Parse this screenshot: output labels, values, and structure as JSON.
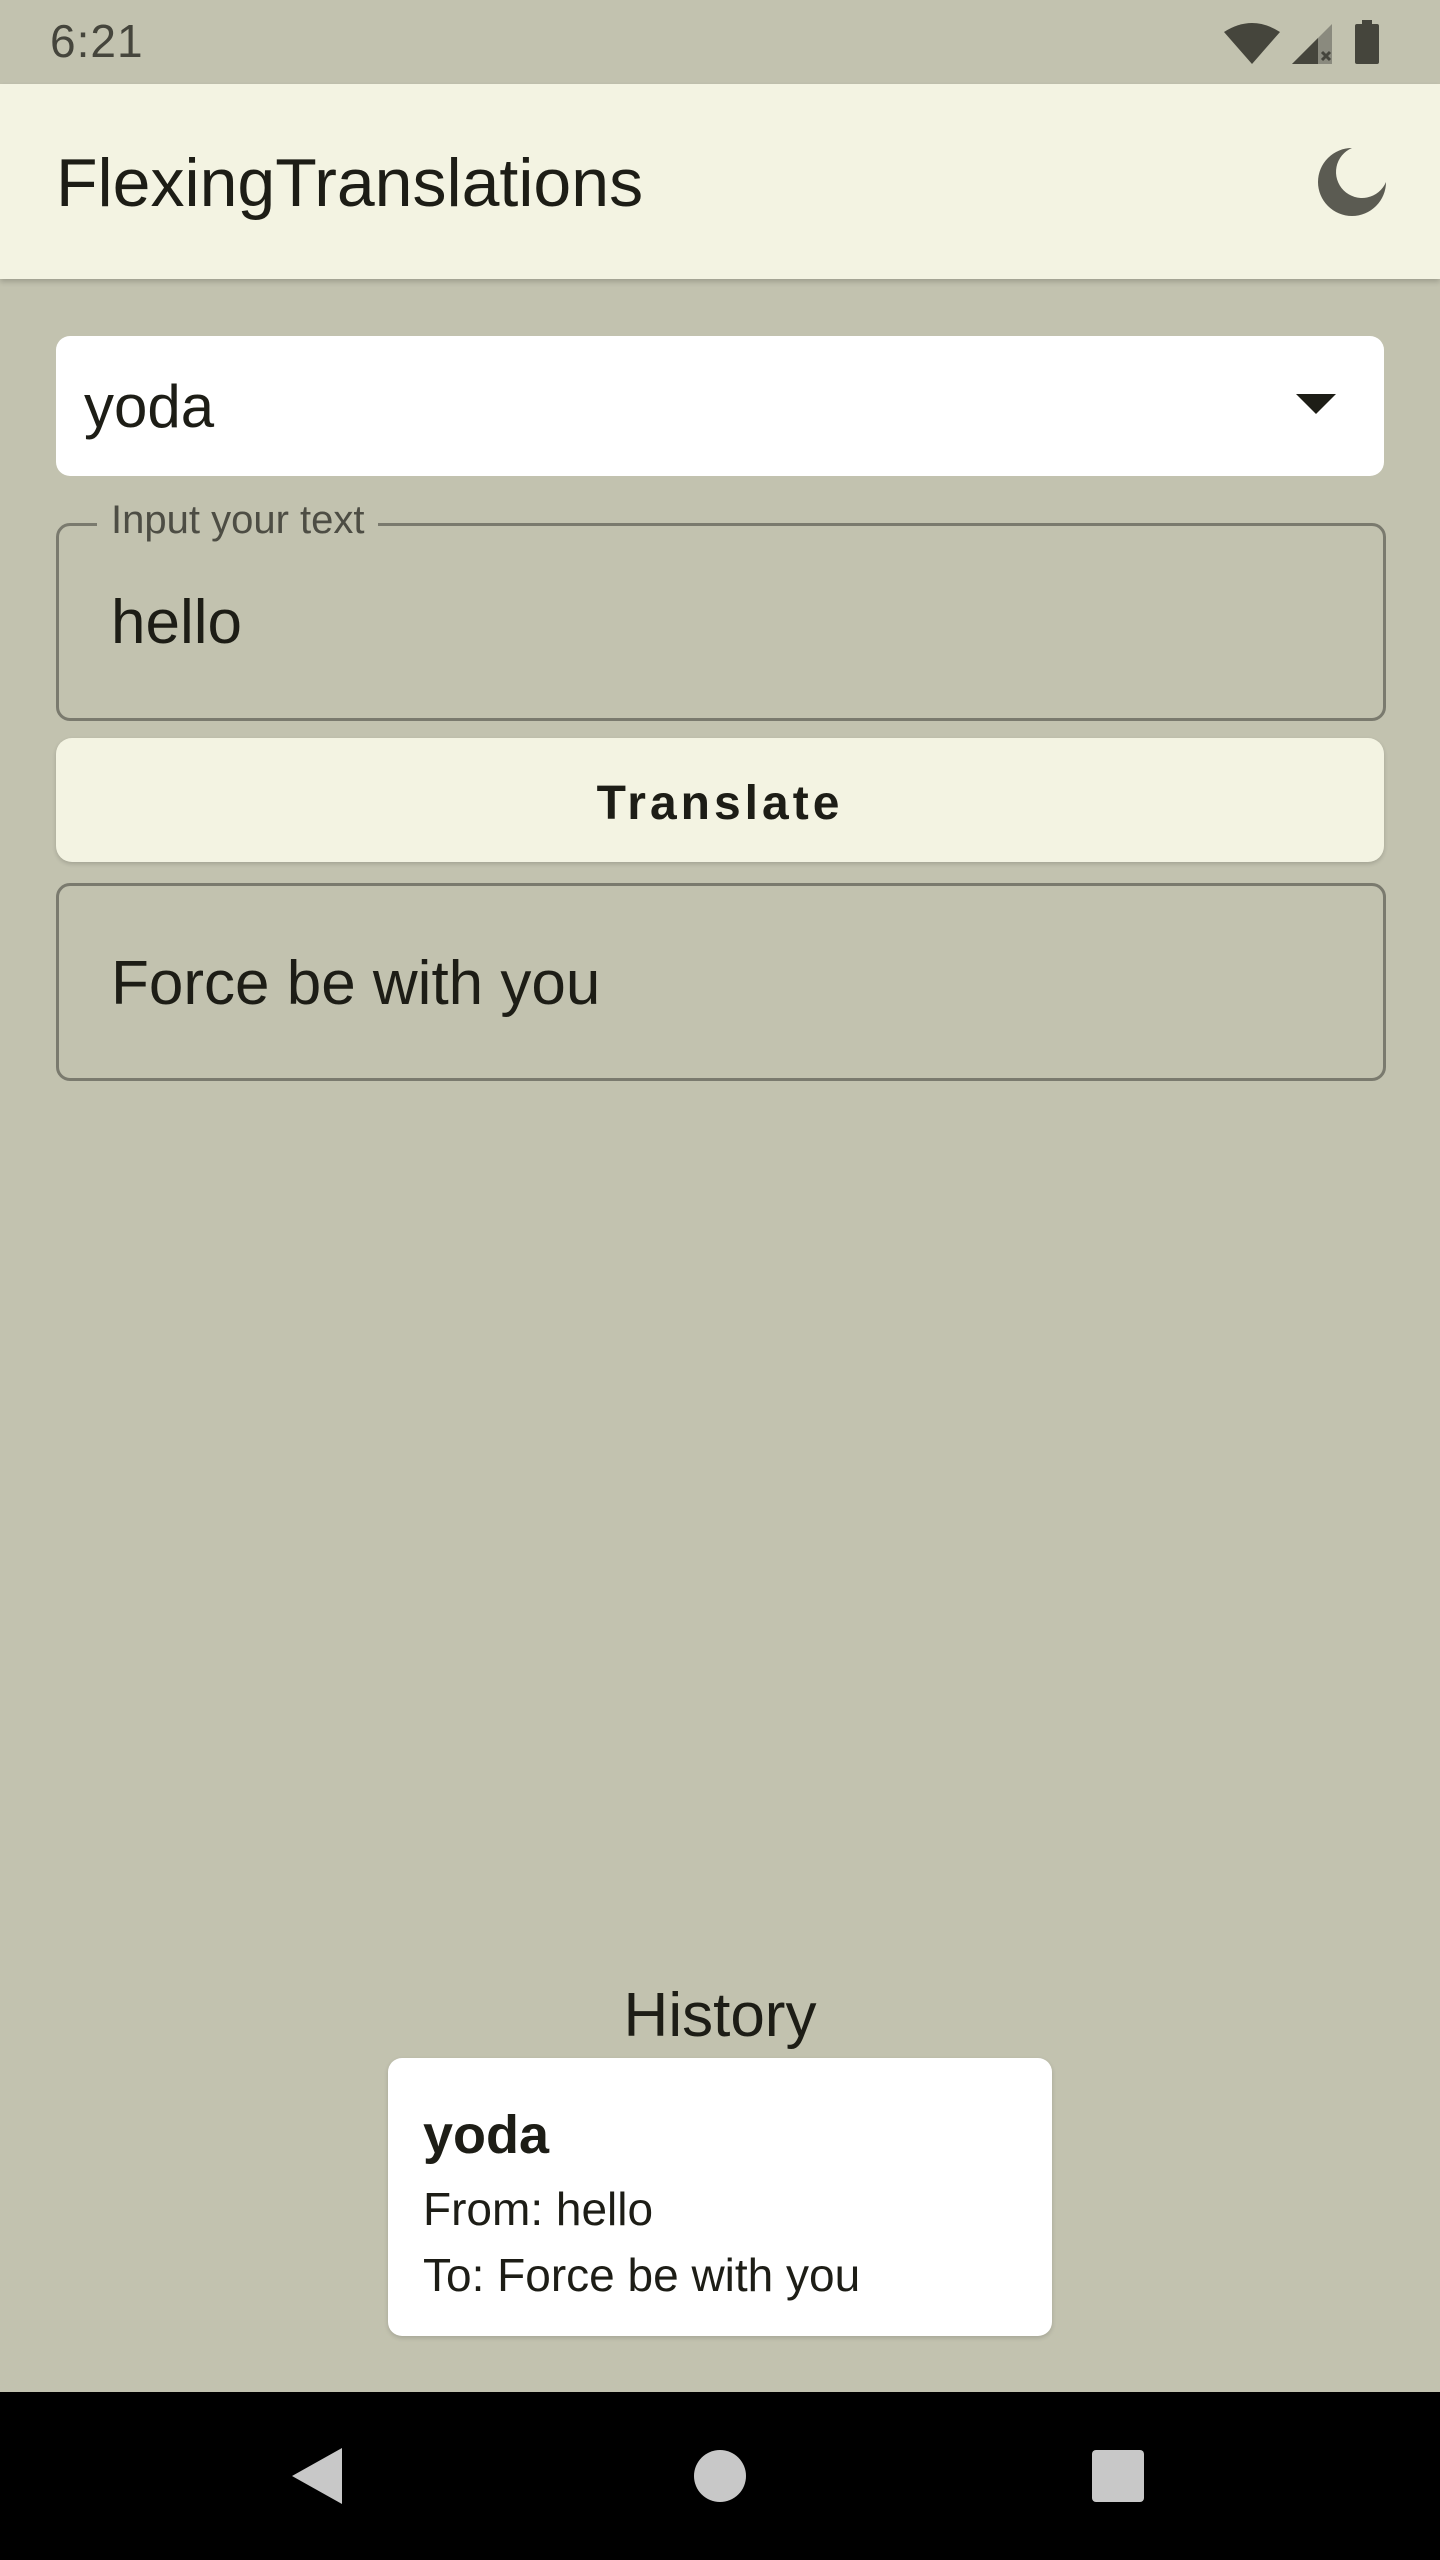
{
  "status_bar": {
    "time": "6:21",
    "icons": [
      "wifi-icon",
      "cell-signal-icon",
      "battery-icon"
    ]
  },
  "app_bar": {
    "title": "FlexingTranslations",
    "theme_toggle_icon": "moon-icon"
  },
  "translator": {
    "selected_language": "yoda",
    "input_label": "Input your text",
    "input_value": "hello",
    "translate_label": "Translate",
    "output_text": "Force be with you"
  },
  "history": {
    "heading": "History",
    "items": [
      {
        "language": "yoda",
        "from": "From: hello",
        "to": "To: Force be with you"
      }
    ]
  },
  "nav_bar": {
    "icons": [
      "back-icon",
      "home-icon",
      "recents-icon"
    ]
  },
  "colors": {
    "background": "#c2c2af",
    "app_bar": "#f3f3e2",
    "card": "#ffffff",
    "border": "#7a7a6e",
    "text": "#1d1d16"
  }
}
